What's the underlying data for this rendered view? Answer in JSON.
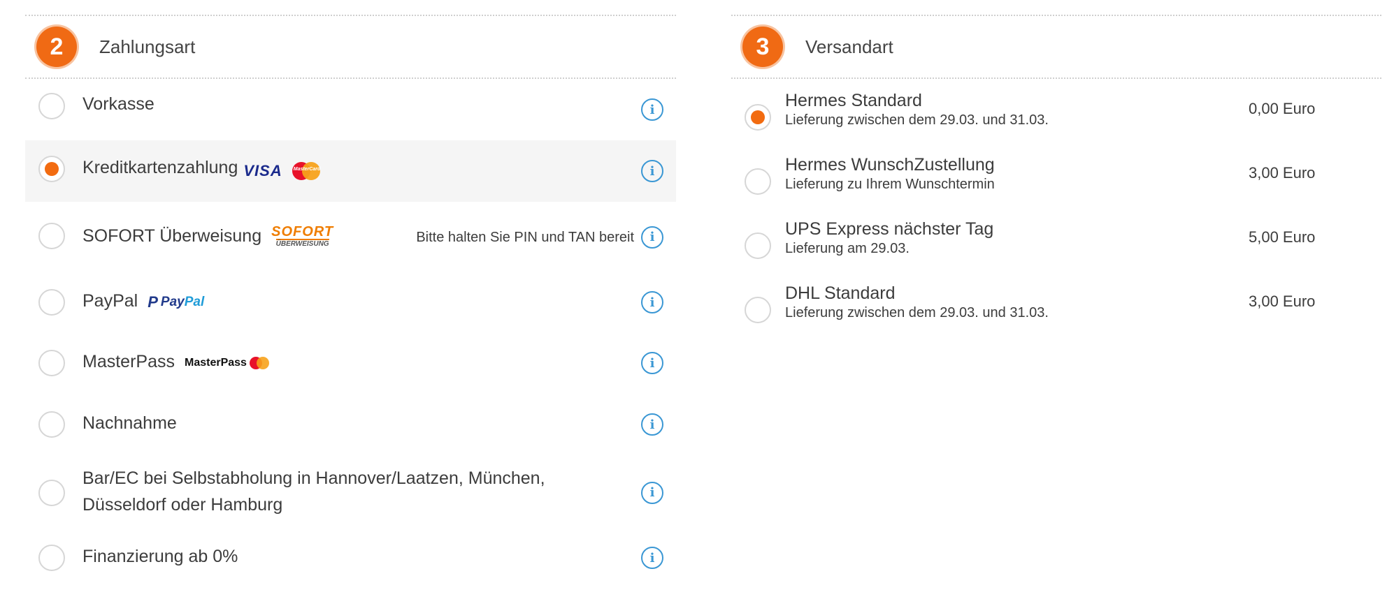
{
  "payment": {
    "step": "2",
    "title": "Zahlungsart",
    "options": [
      {
        "label": "Vorkasse",
        "selected": false
      },
      {
        "label": "Kreditkartenzahlung",
        "selected": true,
        "logos": {
          "visa": "VISA",
          "mastercard": "MasterCard"
        }
      },
      {
        "label": "SOFORT Überweisung",
        "selected": false,
        "logo": {
          "line1": "SOFORT",
          "line2": "ÜBERWEISUNG"
        },
        "hint": "Bitte halten Sie PIN und TAN bereit"
      },
      {
        "label": "PayPal",
        "selected": false,
        "logo": {
          "part1": "Pay",
          "part2": "Pal"
        }
      },
      {
        "label": "MasterPass",
        "selected": false,
        "logo": "MasterPass"
      },
      {
        "label": "Nachnahme",
        "selected": false
      },
      {
        "label": "Bar/EC bei Selbstabholung in Hannover/Laatzen, München,",
        "label_line2": "Düsseldorf oder Hamburg",
        "selected": false
      },
      {
        "label": "Finanzierung ab 0%",
        "selected": false
      }
    ]
  },
  "shipping": {
    "step": "3",
    "title": "Versandart",
    "options": [
      {
        "name": "Hermes Standard",
        "desc": "Lieferung zwischen dem 29.03. und 31.03.",
        "price": "0,00 Euro",
        "selected": true
      },
      {
        "name": "Hermes WunschZustellung",
        "desc": "Lieferung zu Ihrem Wunschtermin",
        "price": "3,00 Euro",
        "selected": false
      },
      {
        "name": "UPS Express nächster Tag",
        "desc": "Lieferung am 29.03.",
        "price": "5,00 Euro",
        "selected": false
      },
      {
        "name": "DHL Standard",
        "desc": "Lieferung zwischen dem 29.03. und 31.03.",
        "price": "3,00 Euro",
        "selected": false
      }
    ]
  },
  "colors": {
    "accent": "#f06a14",
    "info": "#3a97d4",
    "selected_bg": "#f5f5f5"
  },
  "icons": {
    "info": "info-icon",
    "radio": "radio-button"
  }
}
